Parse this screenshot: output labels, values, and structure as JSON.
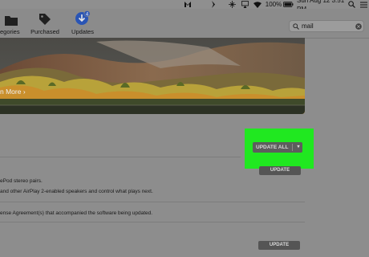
{
  "menubar": {
    "battery_percent": "100%",
    "datetime": "Sun Aug 12  3:51 PM",
    "icons": [
      "malwarebytes-icon",
      "bolt-icon",
      "satellite-icon",
      "airplay-icon",
      "wifi-icon",
      "battery-icon",
      "search-icon",
      "list-icon"
    ]
  },
  "toolbar": {
    "tabs": [
      {
        "label": "egories",
        "icon": "folder-icon"
      },
      {
        "label": "Purchased",
        "icon": "tag-icon"
      },
      {
        "label": "Updates",
        "icon": "updates-icon",
        "badge": "4"
      }
    ],
    "search": {
      "value": "mail",
      "icon": "magnifier-icon",
      "clear_icon": "clear-icon"
    }
  },
  "hero": {
    "link_text": "n More ›"
  },
  "updates": {
    "update_all_label": "UPDATE ALL",
    "update_label": "UPDATE",
    "lines": [
      "ePod stereo pairs.",
      "and other AirPlay 2-enabled speakers and control what plays next.",
      "ense Agreement(s) that accompanied the software being updated."
    ]
  },
  "colors": {
    "highlight": "#20e820",
    "button": "#555555"
  }
}
